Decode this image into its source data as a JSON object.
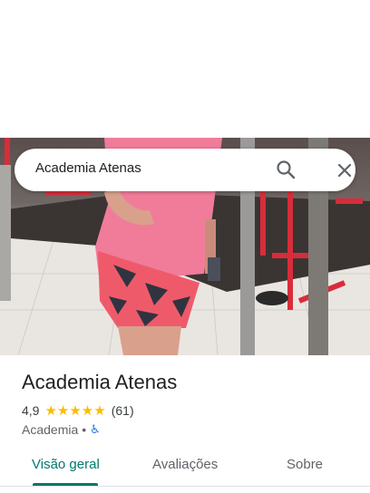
{
  "search": {
    "query": "Academia Atenas"
  },
  "place": {
    "name": "Academia Atenas",
    "rating": "4,9",
    "stars": "★★★★★",
    "review_count": "(61)",
    "category": "Academia",
    "separator": "•",
    "accessibility_icon": "♿"
  },
  "tabs": [
    {
      "label": "Visão geral"
    },
    {
      "label": "Avaliações"
    },
    {
      "label": "Sobre"
    }
  ],
  "colors": {
    "accent": "#00796b",
    "star": "#fbbc04",
    "accessibility": "#1a73e8"
  }
}
